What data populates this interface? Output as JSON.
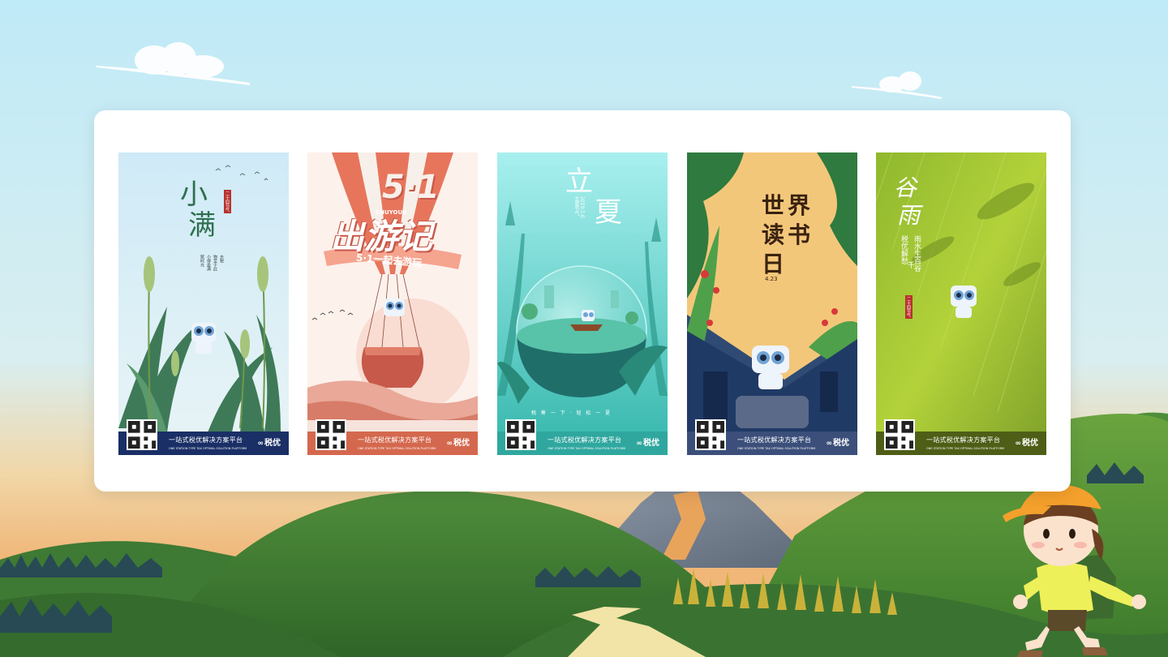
{
  "posters": [
    {
      "title_line1": "小",
      "title_line2": "满",
      "seal": "二十四节气",
      "verse": [
        "物至于此",
        "小得盈满",
        "夫税",
        "赋时光"
      ],
      "footer_slogan": "一站式税优解决方案平台",
      "footer_slogan_en": "ONE STATION TYPE TAX OPTIMAL SOLUTION PLATFORM",
      "brand": "税优"
    },
    {
      "big_number": "5·1",
      "pinyin": "CHUYOUJI",
      "title": "出游记",
      "ribbon": "5·1一起去游玩",
      "footer_slogan": "一站式税优解决方案平台",
      "footer_slogan_en": "ONE STATION TYPE TAX OPTIMAL SOLUTION PLATFORM",
      "brand": "税优"
    },
    {
      "title_line1": "立",
      "title_line2": "夏",
      "date": "2019.5.6",
      "date_label": "立夏节气",
      "bottom_line": "税 筹 一 下 · 轻 松 一 夏",
      "footer_slogan": "一站式税优解决方案平台",
      "footer_slogan_en": "ONE STATION TYPE TAX OPTIMAL SOLUTION PLATFORM",
      "brand": "税优"
    },
    {
      "title_line1": "世界读",
      "title_line2": "书日",
      "title_chars": [
        "世",
        "界",
        "读",
        "书",
        "日"
      ],
      "date": "4.23",
      "footer_slogan": "一站式税优解决方案平台",
      "footer_slogan_en": "ONE STATION TYPE TAX OPTIMAL SOLUTION PLATFORM",
      "brand": "税优"
    },
    {
      "title_line1": "谷",
      "title_line2": "雨",
      "verse_col1": "税优解愁",
      "verse_col2": "雨水生百谷",
      "verse_col3": "千",
      "seal": "二十四节气",
      "footer_slogan": "一站式税优解决方案平台",
      "footer_slogan_en": "ONE STATION TYPE TAX OPTIMAL SOLUTION PLATFORM",
      "brand": "税优"
    }
  ],
  "colors": {
    "sky_top": "#c8eef8",
    "sky_bottom": "#f3c58f",
    "hills": "#4f8a3a",
    "card": "#ffffff",
    "footer_navy": "#1a2f66",
    "footer_coral": "#d4684e",
    "footer_teal": "#2fa79f",
    "footer_slate": "#3b4f7a",
    "footer_olive": "#4e5e16"
  },
  "icons": [
    "cloud-icon",
    "qr-code-icon",
    "mascot-icon",
    "brand-logo-icon",
    "hiker-character-icon"
  ]
}
